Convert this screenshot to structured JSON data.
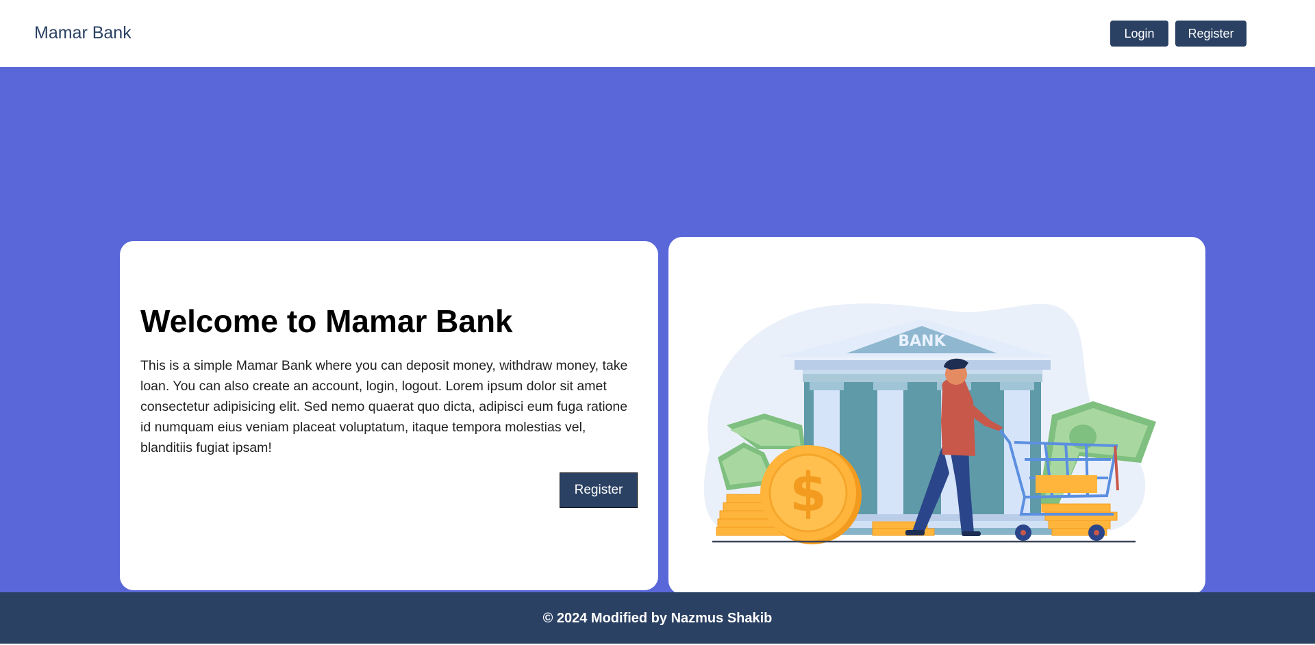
{
  "navbar": {
    "brand": "Mamar Bank",
    "login_label": "Login",
    "register_label": "Register"
  },
  "hero": {
    "title": "Welcome to Mamar Bank",
    "description": "This is a simple Mamar Bank where you can deposit money, withdraw money, take loan. You can also create an account, login, logout. Lorem ipsum dolor sit amet consectetur adipisicing elit. Sed nemo quaerat quo dicta, adipisci eum fuga ratione id numquam eius veniam placeat voluptatum, itaque tempora molestias vel, blanditiis fugiat ipsam!",
    "register_label": "Register",
    "illustration": {
      "bank_sign": "BANK",
      "coin_symbol": "$"
    }
  },
  "footer": {
    "text": "© 2024 Modified by Nazmus Shakib"
  },
  "colors": {
    "primary": "#2b4163",
    "hero_bg": "#5a67d8",
    "coin": "#ffb53b",
    "money": "#8fc98b",
    "bank": "#5e9aa8"
  }
}
